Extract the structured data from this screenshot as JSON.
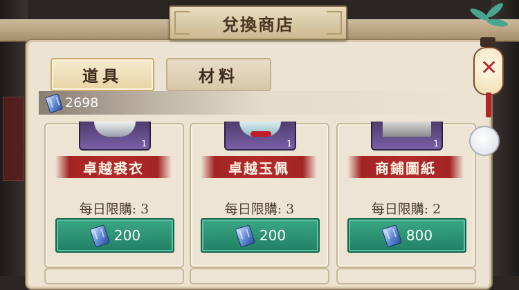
{
  "title": "兌換商店",
  "tabs": [
    {
      "label": "道具",
      "selected": true
    },
    {
      "label": "材料",
      "selected": false
    }
  ],
  "currency": {
    "icon": "currency-token-icon",
    "amount": "2698"
  },
  "items": [
    {
      "name": "卓越裘衣",
      "qty": "1",
      "limit": "每日限購: 3",
      "price": "200"
    },
    {
      "name": "卓越玉佩",
      "qty": "1",
      "limit": "每日限購: 3",
      "price": "200"
    },
    {
      "name": "商鋪圖紙",
      "qty": "1",
      "limit": "每日限購: 2",
      "price": "800"
    }
  ],
  "colors": {
    "panel": "#ece3d2",
    "ribbon": "#b42a2a",
    "price_button": "#2b8f6f",
    "token": "#5f86d3"
  }
}
